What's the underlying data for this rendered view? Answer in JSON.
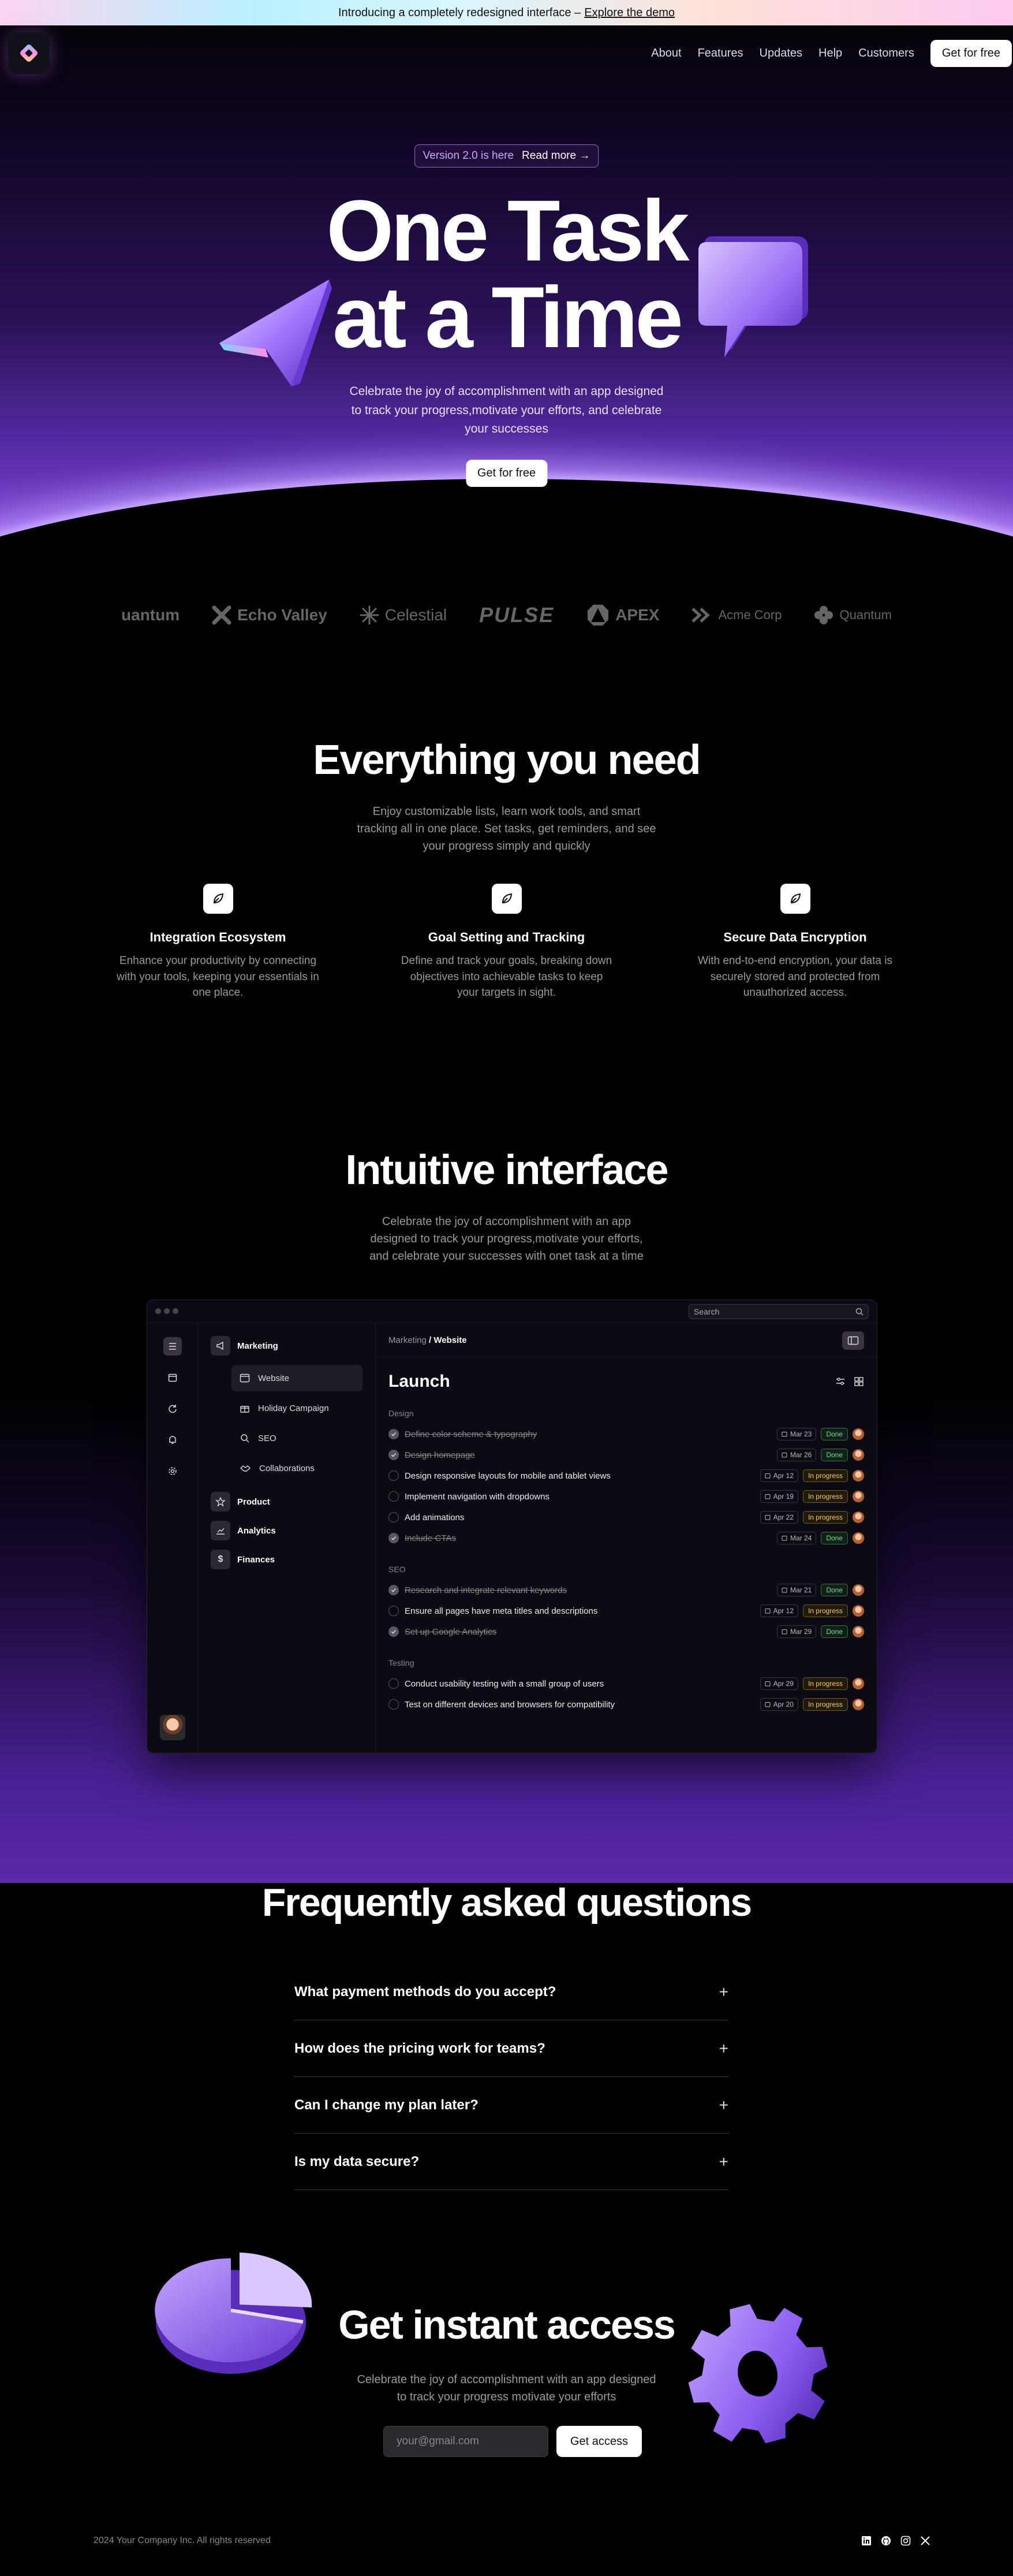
{
  "announcement": {
    "text": "Introducing a completely redesigned interface –",
    "link": "Explore the demo"
  },
  "nav": {
    "links": [
      "About",
      "Features",
      "Updates",
      "Help",
      "Customers"
    ],
    "cta": "Get for free"
  },
  "hero": {
    "pill_version": "Version 2.0 is here",
    "pill_link": "Read more →",
    "title_line1": "One Task",
    "title_line2": "at a Time",
    "subtitle": "Celebrate the joy of accomplishment with an app designed to track your progress,motivate your efforts, and celebrate your successes",
    "cta": "Get for free"
  },
  "logos": [
    "uantum",
    "Echo Valley",
    "Celestial",
    "PULSE",
    "APEX",
    "Acme Corp",
    "Quantum"
  ],
  "features_section": {
    "title": "Everything you need",
    "subtitle": "Enjoy customizable lists, learn work tools, and smart tracking all in one place. Set tasks, get reminders, and see your progress simply and quickly",
    "items": [
      {
        "title": "Integration Ecosystem",
        "text": "Enhance your productivity by connecting with your tools, keeping your essentials in one place."
      },
      {
        "title": "Goal Setting and Tracking",
        "text": "Define and track your goals, breaking down objectives into achievable tasks to keep your targets in sight."
      },
      {
        "title": "Secure Data Encryption",
        "text": "With end-to-end encryption, your data is securely stored and protected from unauthorized access."
      }
    ]
  },
  "interface_section": {
    "title": "Intuitive interface",
    "subtitle": "Celebrate the joy of accomplishment with an app designed to track your progress,motivate your efforts, and celebrate your successes with onet task at a time"
  },
  "app": {
    "search_placeholder": "Search",
    "sidebar": {
      "marketing": "Marketing",
      "marketing_items": [
        "Website",
        "Holiday Campaign",
        "SEO",
        "Collaborations"
      ],
      "product": "Product",
      "analytics": "Analytics",
      "finances": "Finances"
    },
    "breadcrumb": {
      "parent": "Marketing",
      "sep": " / ",
      "current": "Website"
    },
    "heading": "Launch",
    "groups": [
      {
        "label": "Design",
        "tasks": [
          {
            "title": "Define color scheme & typography",
            "date": "Mar 23",
            "status": "Done",
            "done": true
          },
          {
            "title": "Design homepage",
            "date": "Mar 26",
            "status": "Done",
            "done": true
          },
          {
            "title": "Design responsive layouts for mobile and tablet views",
            "date": "Apr 12",
            "status": "In progress",
            "done": false
          },
          {
            "title": "Implement navigation with dropdowns",
            "date": "Apr 19",
            "status": "In progress",
            "done": false
          },
          {
            "title": "Add animations",
            "date": "Apr 22",
            "status": "In progress",
            "done": false
          },
          {
            "title": "Include CTAs",
            "date": "Mar 24",
            "status": "Done",
            "done": true
          }
        ]
      },
      {
        "label": "SEO",
        "tasks": [
          {
            "title": "Research and integrate relevant keywords",
            "date": "Mar 21",
            "status": "Done",
            "done": true
          },
          {
            "title": "Ensure all pages have meta titles and descriptions",
            "date": "Apr 12",
            "status": "In progress",
            "done": false
          },
          {
            "title": "Set up Google Analytics",
            "date": "Mar 29",
            "status": "Done",
            "done": true
          }
        ]
      },
      {
        "label": "Testing",
        "tasks": [
          {
            "title": "Conduct usability testing with a small group of users",
            "date": "Apr 29",
            "status": "In progress",
            "done": false
          },
          {
            "title": "Test on different devices and browsers for compatibility",
            "date": "Apr 20",
            "status": "In progress",
            "done": false
          }
        ]
      }
    ]
  },
  "faq": {
    "title": "Frequently asked questions",
    "items": [
      "What payment methods do you accept?",
      "How does the pricing work for teams?",
      "Can I change my plan later?",
      "Is my data secure?"
    ]
  },
  "access": {
    "title": "Get instant access",
    "subtitle": "Celebrate the joy of accomplishment with an app designed to track your progress motivate your efforts",
    "email_placeholder": "your@gmail.com",
    "cta": "Get access"
  },
  "footer": {
    "copyright": "2024 Your Company Inc. All rights reserved"
  },
  "colors": {
    "accent": "#7d4ad4",
    "accent_light": "#a27bff",
    "done": "#7fd69a",
    "in_progress": "#f2c96a"
  }
}
